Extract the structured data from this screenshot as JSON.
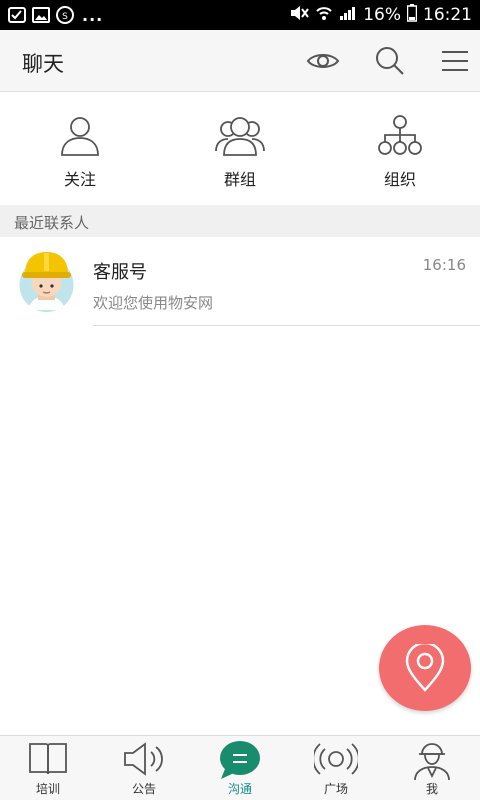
{
  "status_bar": {
    "dots": "...",
    "battery": "16%",
    "time": "16:21"
  },
  "header": {
    "title": "聊天",
    "icons": [
      "eye-icon",
      "search-icon",
      "menu-icon"
    ]
  },
  "quick_actions": [
    {
      "label": "关注",
      "icon": "person-icon"
    },
    {
      "label": "群组",
      "icon": "group-icon"
    },
    {
      "label": "组织",
      "icon": "org-chart-icon"
    }
  ],
  "section": {
    "recent_contacts": "最近联系人"
  },
  "contacts": [
    {
      "name": "客服号",
      "message": "欢迎您使用物安网",
      "time": "16:16"
    }
  ],
  "fab": {
    "icon": "location-icon"
  },
  "bottom_nav": {
    "items": [
      {
        "label": "培训",
        "icon": "book-icon"
      },
      {
        "label": "公告",
        "icon": "speaker-icon"
      },
      {
        "label": "沟通",
        "icon": "chat-icon",
        "active": true
      },
      {
        "label": "广场",
        "icon": "broadcast-icon"
      },
      {
        "label": "我",
        "icon": "worker-icon"
      }
    ]
  },
  "colors": {
    "accent": "#1a8c8c",
    "fab": "#f26d6d"
  }
}
